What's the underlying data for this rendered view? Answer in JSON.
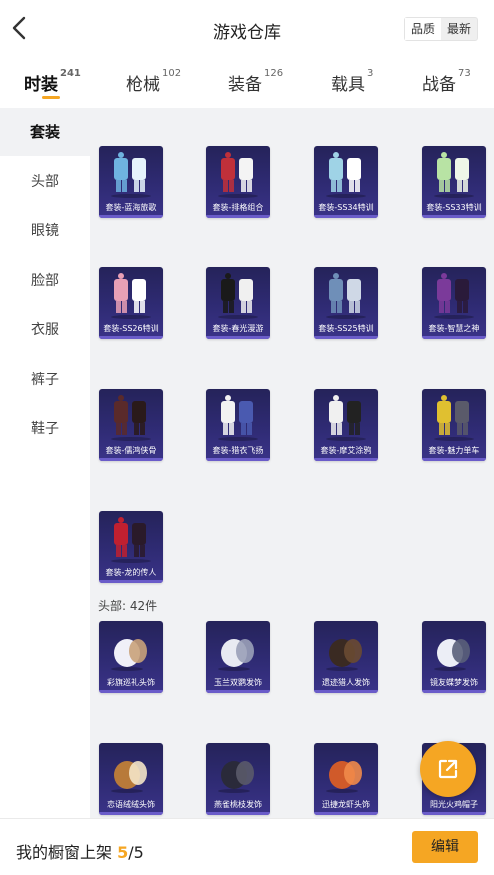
{
  "header": {
    "title": "游戏仓库",
    "back_icon": "chevron-left-icon"
  },
  "sort": {
    "options": [
      "品质",
      "最新"
    ],
    "selected": "品质"
  },
  "tabs": [
    {
      "label": "时装",
      "count": "241"
    },
    {
      "label": "枪械",
      "count": "102"
    },
    {
      "label": "装备",
      "count": "126"
    },
    {
      "label": "载具",
      "count": "3"
    },
    {
      "label": "战备",
      "count": "73"
    }
  ],
  "active_tab": "时装",
  "sidebar": {
    "items": [
      "套装",
      "头部",
      "眼镜",
      "脸部",
      "衣服",
      "裤子",
      "鞋子"
    ],
    "active": "套装"
  },
  "suits": [
    {
      "label": "套装-蓝海旅歌"
    },
    {
      "label": "套装-排格组合"
    },
    {
      "label": "套装-SS34特训"
    },
    {
      "label": "套装-SS33特训"
    },
    {
      "label": "套装-SS26特训"
    },
    {
      "label": "套装-春光漫游"
    },
    {
      "label": "套装-SS25特训"
    },
    {
      "label": "套装-智慧之神"
    },
    {
      "label": "套装-儒鸿侠骨"
    },
    {
      "label": "套装-猎衣飞扬"
    },
    {
      "label": "套装-摩艾涂鸦"
    },
    {
      "label": "套装-魅力单车"
    },
    {
      "label": "套装-龙的传人"
    }
  ],
  "head_section": {
    "title": "头部: 42件"
  },
  "heads": [
    {
      "label": "彩旗巡礼头饰"
    },
    {
      "label": "玉兰双鹦发饰"
    },
    {
      "label": "遗迹猎人发饰"
    },
    {
      "label": "镜友蝶梦发饰"
    },
    {
      "label": "恋语绒绒头饰"
    },
    {
      "label": "燕雀桃枝发饰"
    },
    {
      "label": "迅捷龙虾头饰"
    },
    {
      "label": "阳光火鸡帽子"
    }
  ],
  "footer": {
    "showcase_label": "我的橱窗上架",
    "showcase_current": "5",
    "showcase_total": "/5",
    "edit_label": "编辑"
  },
  "fab": {
    "icon": "share-external-icon"
  },
  "colors": {
    "accent": "#f5a623",
    "card_bg": "#2f2b74",
    "panel_bg": "#f1f2f4"
  }
}
